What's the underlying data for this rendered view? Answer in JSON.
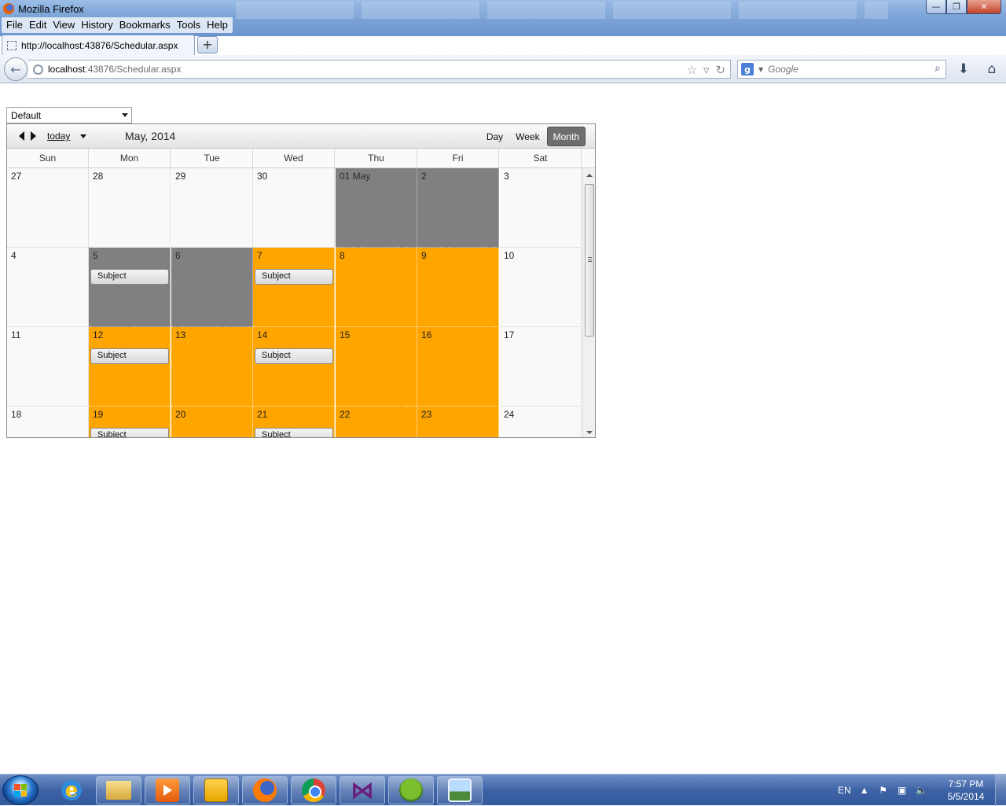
{
  "window": {
    "title": "Mozilla Firefox",
    "controls": {
      "minimize": "—",
      "maximize": "❐",
      "close": "✕"
    }
  },
  "menubar": [
    "File",
    "Edit",
    "View",
    "History",
    "Bookmarks",
    "Tools",
    "Help"
  ],
  "tab": {
    "title": "http://localhost:43876/Schedular.aspx",
    "newtab_label": "+"
  },
  "urlbar": {
    "host": "localhost",
    "rest": ":43876/Schedular.aspx"
  },
  "search": {
    "engine_icon": "g",
    "placeholder": "Google"
  },
  "view_select": {
    "value": "Default"
  },
  "scheduler": {
    "today_label": "today",
    "title": "May, 2014",
    "views": [
      "Day",
      "Week",
      "Month"
    ],
    "active_view": "Month",
    "day_names": [
      "Sun",
      "Mon",
      "Tue",
      "Wed",
      "Thu",
      "Fri",
      "Sat"
    ],
    "colors": {
      "gray": "#808080",
      "orange": "#FFA500",
      "default": "#F9F9F9",
      "active_view": "#6E6E6E"
    },
    "weeks": [
      [
        {
          "label": "27",
          "color": "default"
        },
        {
          "label": "28",
          "color": "default"
        },
        {
          "label": "29",
          "color": "default"
        },
        {
          "label": "30",
          "color": "default"
        },
        {
          "label": "01 May",
          "color": "gray"
        },
        {
          "label": "2",
          "color": "gray"
        },
        {
          "label": "3",
          "color": "default"
        }
      ],
      [
        {
          "label": "4",
          "color": "default"
        },
        {
          "label": "5",
          "color": "gray",
          "appointment": "Subject"
        },
        {
          "label": "6",
          "color": "gray"
        },
        {
          "label": "7",
          "color": "orange",
          "appointment": "Subject"
        },
        {
          "label": "8",
          "color": "orange"
        },
        {
          "label": "9",
          "color": "orange"
        },
        {
          "label": "10",
          "color": "default"
        }
      ],
      [
        {
          "label": "11",
          "color": "default"
        },
        {
          "label": "12",
          "color": "orange",
          "appointment": "Subject"
        },
        {
          "label": "13",
          "color": "orange"
        },
        {
          "label": "14",
          "color": "orange",
          "appointment": "Subject"
        },
        {
          "label": "15",
          "color": "orange"
        },
        {
          "label": "16",
          "color": "orange"
        },
        {
          "label": "17",
          "color": "default"
        }
      ],
      [
        {
          "label": "18",
          "color": "default"
        },
        {
          "label": "19",
          "color": "orange",
          "appointment": "Subject"
        },
        {
          "label": "20",
          "color": "orange"
        },
        {
          "label": "21",
          "color": "orange",
          "appointment": "Subject"
        },
        {
          "label": "22",
          "color": "orange"
        },
        {
          "label": "23",
          "color": "orange"
        },
        {
          "label": "24",
          "color": "default"
        }
      ]
    ]
  },
  "taskbar": {
    "apps": [
      {
        "name": "internet-explorer",
        "running": false
      },
      {
        "name": "windows-explorer",
        "running": true
      },
      {
        "name": "media-player",
        "running": true
      },
      {
        "name": "outlook",
        "running": true
      },
      {
        "name": "firefox",
        "running": true
      },
      {
        "name": "chrome",
        "running": true
      },
      {
        "name": "visual-studio",
        "running": true
      },
      {
        "name": "frog-app",
        "running": true
      },
      {
        "name": "photo-viewer",
        "running": true
      }
    ],
    "language": "EN",
    "time": "7:57 PM",
    "date": "5/5/2014"
  }
}
